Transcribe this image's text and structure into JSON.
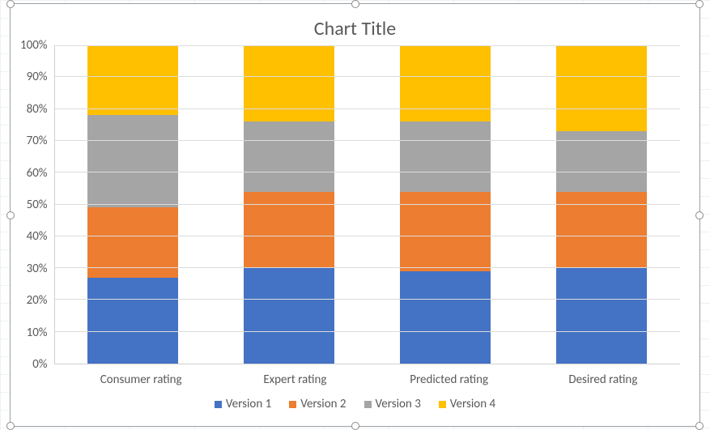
{
  "chart_data": {
    "type": "bar",
    "stacked": "percent",
    "title": "Chart Title",
    "xlabel": "",
    "ylabel": "",
    "ylim": [
      0,
      100
    ],
    "y_ticks_pct": [
      100,
      90,
      80,
      70,
      60,
      50,
      40,
      30,
      20,
      10,
      0
    ],
    "y_tick_labels": [
      "100%",
      "90%",
      "80%",
      "70%",
      "60%",
      "50%",
      "40%",
      "30%",
      "20%",
      "10%",
      "0%"
    ],
    "categories": [
      "Consumer rating",
      "Expert rating",
      "Predicted rating",
      "Desired rating"
    ],
    "series": [
      {
        "name": "Version 1",
        "color": "#4472C4",
        "values_pct": [
          27,
          30,
          29,
          30
        ]
      },
      {
        "name": "Version 2",
        "color": "#ED7D31",
        "values_pct": [
          22,
          24,
          25,
          24
        ]
      },
      {
        "name": "Version 3",
        "color": "#A5A5A5",
        "values_pct": [
          29,
          22,
          22,
          19
        ]
      },
      {
        "name": "Version 4",
        "color": "#FFC000",
        "values_pct": [
          22,
          24,
          24,
          27
        ]
      }
    ]
  }
}
